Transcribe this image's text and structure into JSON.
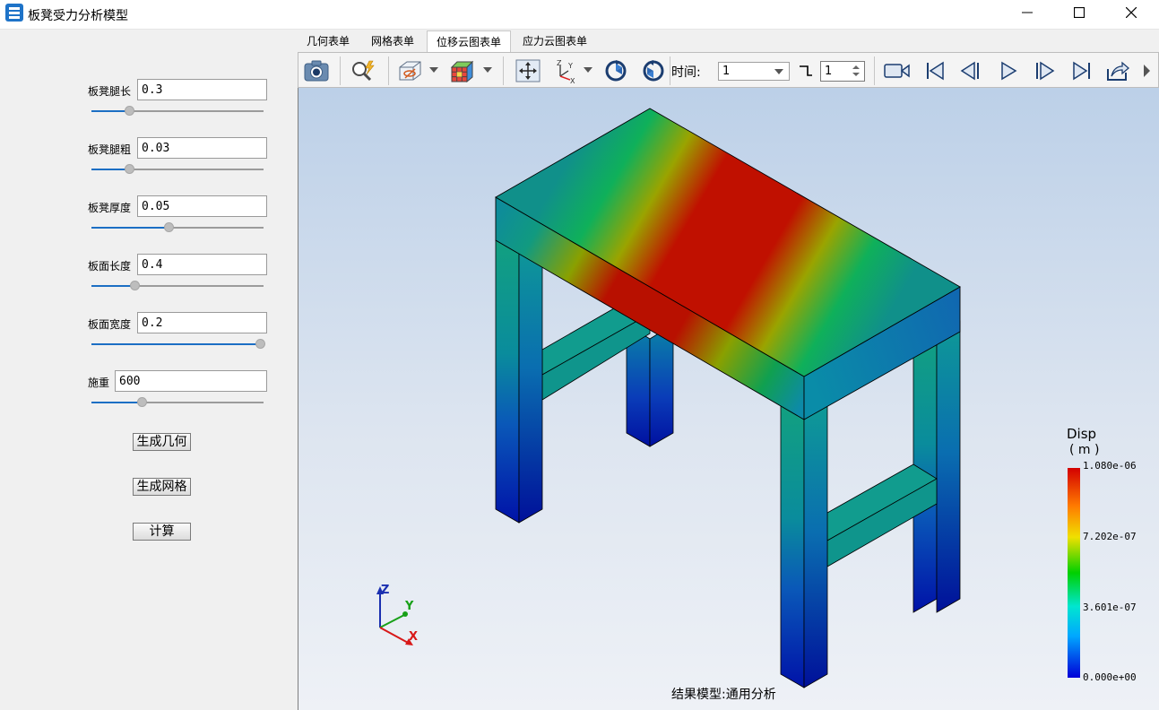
{
  "window": {
    "title": "板凳受力分析模型",
    "minimize_icon": "minimize-icon",
    "maximize_icon": "maximize-icon",
    "close_icon": "close-icon"
  },
  "params": [
    {
      "label": "板凳腿长",
      "value": "0.3",
      "slider_fraction": 0.22
    },
    {
      "label": "板凳腿粗",
      "value": "0.03",
      "slider_fraction": 0.22
    },
    {
      "label": "板凳厚度",
      "value": "0.05",
      "slider_fraction": 0.45
    },
    {
      "label": "板面长度",
      "value": "0.4",
      "slider_fraction": 0.25
    },
    {
      "label": "板面宽度",
      "value": "0.2",
      "slider_fraction": 0.98
    },
    {
      "label": "施重",
      "value": "600",
      "slider_fraction": 0.29
    }
  ],
  "buttons": {
    "gen_geometry": "生成几何",
    "gen_mesh": "生成网格",
    "compute": "计算"
  },
  "tabs": [
    {
      "label": "几何表单",
      "active": false
    },
    {
      "label": "网格表单",
      "active": false
    },
    {
      "label": "位移云图表单",
      "active": true
    },
    {
      "label": "应力云图表单",
      "active": false
    }
  ],
  "toolbar": {
    "time_label": "时间:",
    "time_value": "1",
    "step_value": "1",
    "icons": [
      "camera-icon",
      "zoom-icon",
      "display-style-icon",
      "colormap-icon",
      "fit-view-icon",
      "axes-orientation-icon",
      "rotate-left-icon",
      "rotate-right-icon",
      "step-icon",
      "record-icon",
      "first-frame-icon",
      "prev-frame-icon",
      "play-icon",
      "next-frame-icon",
      "last-frame-icon",
      "export-icon",
      "more-icon"
    ]
  },
  "viewport": {
    "footer": "结果模型:通用分析",
    "axis_labels": {
      "z": "Z",
      "y": "Y",
      "x": "X"
    }
  },
  "legend": {
    "title": "Disp",
    "unit": "( m )",
    "ticks": [
      "1.080e-06",
      "7.202e-07",
      "3.601e-07",
      "0.000e+00"
    ],
    "colors": [
      "#d30000",
      "#ff7a00",
      "#f0e000",
      "#00d000",
      "#00e6d0",
      "#00a8ff",
      "#0000d8"
    ]
  }
}
